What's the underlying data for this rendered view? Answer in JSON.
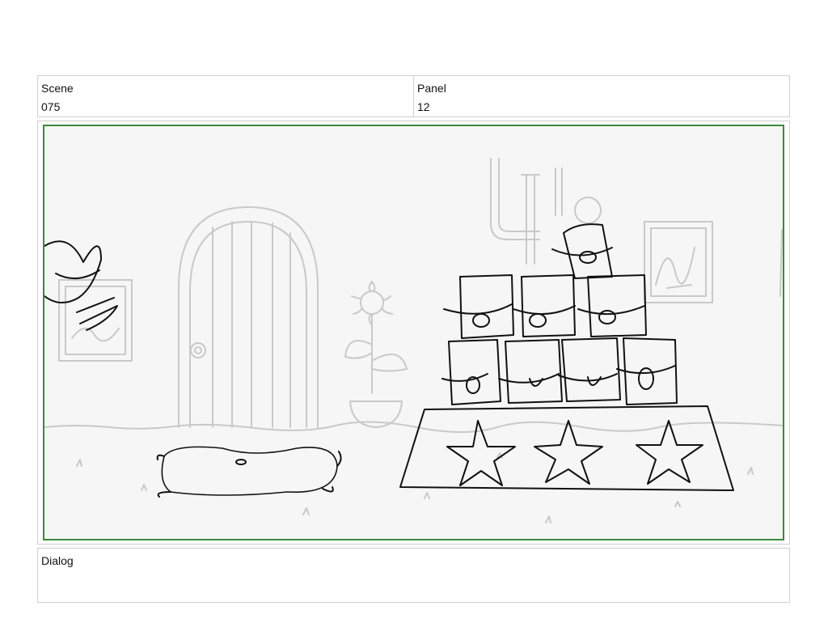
{
  "header": {
    "scene_label": "Scene",
    "scene_value": "075",
    "panel_label": "Panel",
    "panel_value": "12"
  },
  "dialog": {
    "label": "Dialog",
    "text": ""
  },
  "colors": {
    "frame_border": "#3a8a3a",
    "background_sketch": "#c8c8c8",
    "foreground_ink": "#111111"
  }
}
